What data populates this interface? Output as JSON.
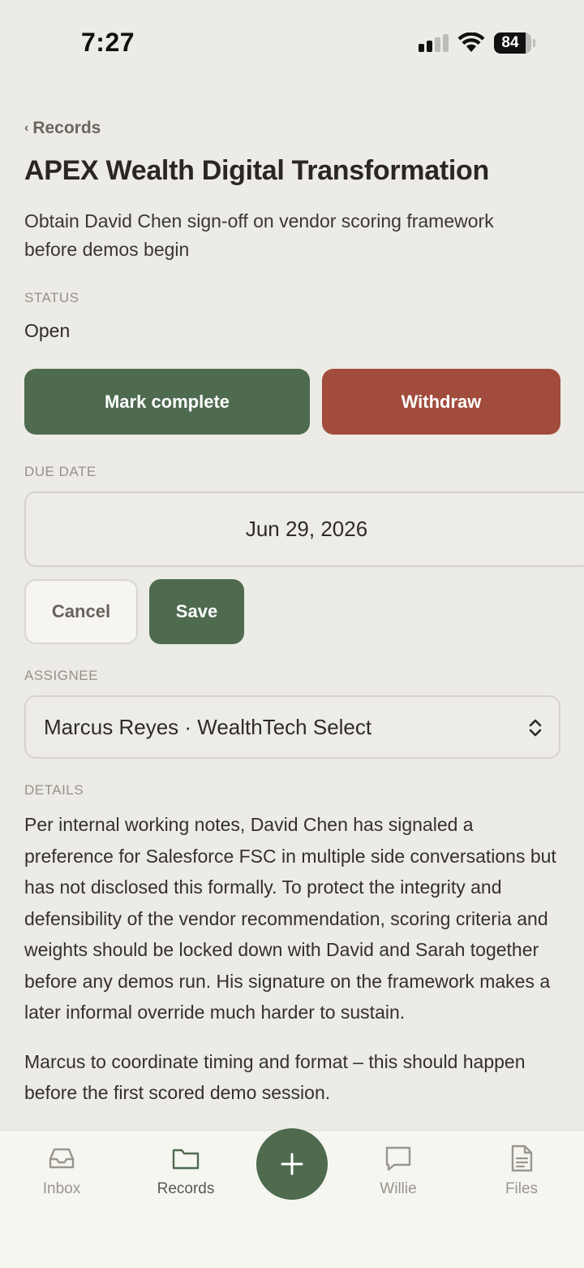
{
  "status_bar": {
    "time": "7:27",
    "battery_level": 84,
    "battery_text": "84"
  },
  "nav": {
    "back_label": "Records"
  },
  "record": {
    "title": "APEX Wealth Digital Transformation",
    "subtitle": "Obtain David Chen sign-off on vendor scoring framework before demos begin"
  },
  "status": {
    "label": "STATUS",
    "value": "Open"
  },
  "actions": {
    "complete_label": "Mark complete",
    "withdraw_label": "Withdraw"
  },
  "due_date": {
    "label": "DUE DATE",
    "value": "Jun 29, 2026",
    "cancel_label": "Cancel",
    "save_label": "Save"
  },
  "assignee": {
    "label": "ASSIGNEE",
    "selected": "Marcus Reyes · WealthTech Select"
  },
  "details": {
    "label": "DETAILS",
    "paragraphs": [
      "Per internal working notes, David Chen has signaled a preference for Salesforce FSC in multiple side conversations but has not disclosed this formally. To protect the integrity and defensibility of the vendor recommendation, scoring criteria and weights should be locked down with David and Sarah together before any demos run. His signature on the framework makes a later informal override much harder to sustain.",
      "Marcus to coordinate timing and format – this should happen before the first scored demo session."
    ]
  },
  "tab_bar": {
    "tabs": [
      {
        "label": "Inbox",
        "icon": "inbox-icon",
        "active": false
      },
      {
        "label": "Records",
        "icon": "folder-icon",
        "active": true
      },
      {
        "label": "Willie",
        "icon": "chat-bubble-icon",
        "active": false
      },
      {
        "label": "Files",
        "icon": "document-icon",
        "active": false
      }
    ],
    "fab_icon": "plus-icon"
  },
  "colors": {
    "background": "#ecebe5",
    "primary_green": "#4e6a4f",
    "withdraw_red": "#a24c3d",
    "muted_label": "#96918a"
  }
}
